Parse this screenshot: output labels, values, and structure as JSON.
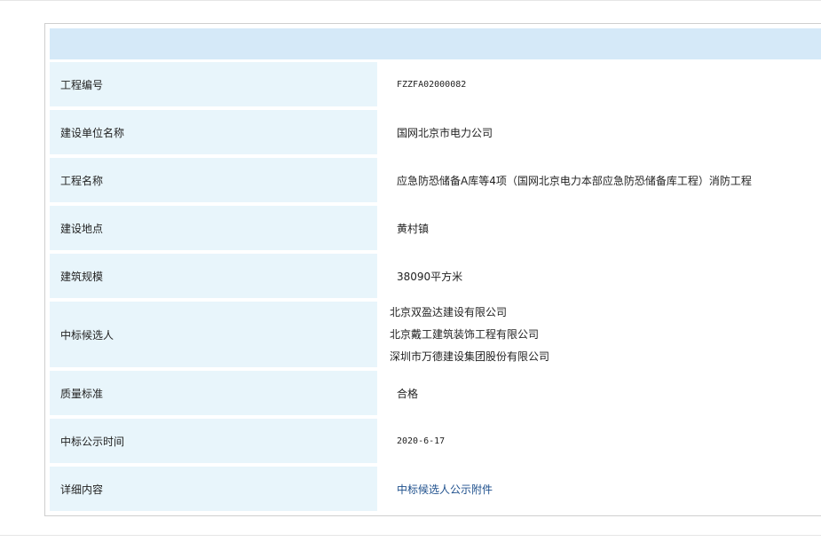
{
  "rows": [
    {
      "label": "工程编号",
      "value": "FZZFA02000082"
    },
    {
      "label": "建设单位名称",
      "value": "国网北京市电力公司"
    },
    {
      "label": "工程名称",
      "value": "应急防恐储备A库等4项（国网北京电力本部应急防恐储备库工程）消防工程"
    },
    {
      "label": "建设地点",
      "value": "黄村镇"
    },
    {
      "label": "建筑规模",
      "value": "38090平方米"
    },
    {
      "label": "中标候选人",
      "values": [
        "北京双盈达建设有限公司",
        "北京戴工建筑装饰工程有限公司",
        "深圳市万德建设集团股份有限公司"
      ]
    },
    {
      "label": "质量标准",
      "value": "合格"
    },
    {
      "label": "中标公示时间",
      "value": "2020-6-17"
    },
    {
      "label": "详细内容",
      "value": "中标候选人公示附件"
    }
  ]
}
